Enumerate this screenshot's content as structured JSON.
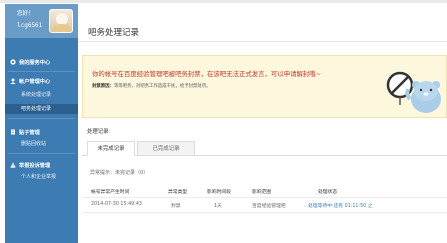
{
  "sidebar": {
    "greeting": "您好！",
    "username": "lcg6561",
    "sections": [
      {
        "label": "我的服务中心",
        "icon": "service-center-icon",
        "items": []
      },
      {
        "label": "帐户管理中心",
        "icon": "user-icon",
        "items": [
          "系统处理记录",
          "吧务处理记录"
        ]
      },
      {
        "label": "贴子管理",
        "icon": "document-icon",
        "items": [
          "删贴回收站"
        ]
      },
      {
        "label": "举报投诉管理",
        "icon": "report-icon",
        "items": [
          "个人和企业举报"
        ]
      }
    ],
    "active_item": "吧务处理记录"
  },
  "main": {
    "title": "吧务处理记录",
    "notice": {
      "message": "你的帐号在百度经验管理吧被吧务封禁，在该吧无法正式发言，可以申请解封哦~",
      "sub_label": "封禁原因：",
      "sub_text": "等等吧务，对吧务工作造成干扰，给予封禁处罚。"
    },
    "records": {
      "section_label": "处理记录",
      "tabs": [
        "未完成记录",
        "已完成记录"
      ],
      "active_tab": "未完成记录",
      "tip": "异常提示：未完记录（0）",
      "columns": [
        "帐号异常产生时间",
        "异常类型",
        "影响时间段",
        "影响范围",
        "处理状态"
      ],
      "rows": [
        [
          "2014-07-30 15:49:43",
          "封禁",
          "1天",
          "百度经验管理吧",
          "处理等待中·还有 01:11:50 之"
        ]
      ]
    }
  },
  "colors": {
    "sidebar_bg": "#3d7bb3",
    "notice_bg": "#fdf7de",
    "notice_text": "#c0392b",
    "link": "#3b78b9"
  }
}
